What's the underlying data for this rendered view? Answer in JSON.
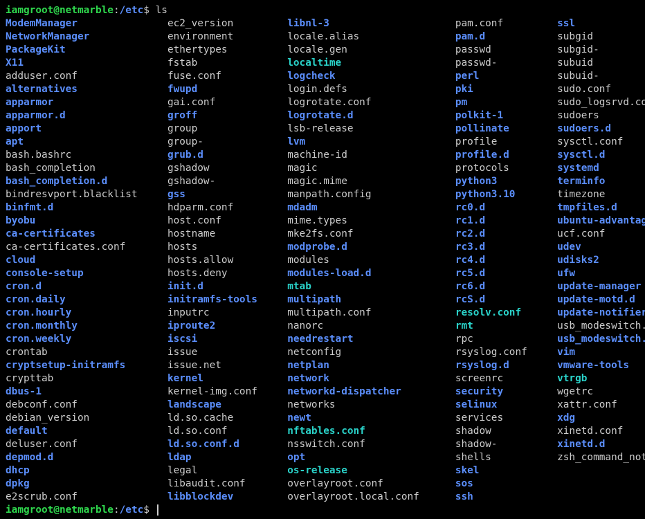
{
  "prompt": {
    "user": "iamgroot",
    "at": "@",
    "host": "netmarble",
    "colon": ":",
    "path": "/etc",
    "dollar": "$ "
  },
  "command": "ls",
  "cols_widths_ch": [
    27,
    20,
    28,
    17,
    0
  ],
  "listing": [
    [
      {
        "t": "ModemManager",
        "c": "d"
      },
      {
        "t": "ec2_version",
        "c": "n"
      },
      {
        "t": "libnl-3",
        "c": "d"
      },
      {
        "t": "pam.conf",
        "c": "n"
      },
      {
        "t": "ssl",
        "c": "d"
      }
    ],
    [
      {
        "t": "NetworkManager",
        "c": "d"
      },
      {
        "t": "environment",
        "c": "n"
      },
      {
        "t": "locale.alias",
        "c": "n"
      },
      {
        "t": "pam.d",
        "c": "d"
      },
      {
        "t": "subgid",
        "c": "n"
      }
    ],
    [
      {
        "t": "PackageKit",
        "c": "d"
      },
      {
        "t": "ethertypes",
        "c": "n"
      },
      {
        "t": "locale.gen",
        "c": "n"
      },
      {
        "t": "passwd",
        "c": "n"
      },
      {
        "t": "subgid-",
        "c": "n"
      }
    ],
    [
      {
        "t": "X11",
        "c": "d"
      },
      {
        "t": "fstab",
        "c": "n"
      },
      {
        "t": "localtime",
        "c": "l"
      },
      {
        "t": "passwd-",
        "c": "n"
      },
      {
        "t": "subuid",
        "c": "n"
      }
    ],
    [
      {
        "t": "adduser.conf",
        "c": "n"
      },
      {
        "t": "fuse.conf",
        "c": "n"
      },
      {
        "t": "logcheck",
        "c": "d"
      },
      {
        "t": "perl",
        "c": "d"
      },
      {
        "t": "subuid-",
        "c": "n"
      }
    ],
    [
      {
        "t": "alternatives",
        "c": "d"
      },
      {
        "t": "fwupd",
        "c": "d"
      },
      {
        "t": "login.defs",
        "c": "n"
      },
      {
        "t": "pki",
        "c": "d"
      },
      {
        "t": "sudo.conf",
        "c": "n"
      }
    ],
    [
      {
        "t": "apparmor",
        "c": "d"
      },
      {
        "t": "gai.conf",
        "c": "n"
      },
      {
        "t": "logrotate.conf",
        "c": "n"
      },
      {
        "t": "pm",
        "c": "d"
      },
      {
        "t": "sudo_logsrvd.conf",
        "c": "n"
      }
    ],
    [
      {
        "t": "apparmor.d",
        "c": "d"
      },
      {
        "t": "groff",
        "c": "d"
      },
      {
        "t": "logrotate.d",
        "c": "d"
      },
      {
        "t": "polkit-1",
        "c": "d"
      },
      {
        "t": "sudoers",
        "c": "n"
      }
    ],
    [
      {
        "t": "apport",
        "c": "d"
      },
      {
        "t": "group",
        "c": "n"
      },
      {
        "t": "lsb-release",
        "c": "n"
      },
      {
        "t": "pollinate",
        "c": "d"
      },
      {
        "t": "sudoers.d",
        "c": "d"
      }
    ],
    [
      {
        "t": "apt",
        "c": "d"
      },
      {
        "t": "group-",
        "c": "n"
      },
      {
        "t": "lvm",
        "c": "d"
      },
      {
        "t": "profile",
        "c": "n"
      },
      {
        "t": "sysctl.conf",
        "c": "n"
      }
    ],
    [
      {
        "t": "bash.bashrc",
        "c": "n"
      },
      {
        "t": "grub.d",
        "c": "d"
      },
      {
        "t": "machine-id",
        "c": "n"
      },
      {
        "t": "profile.d",
        "c": "d"
      },
      {
        "t": "sysctl.d",
        "c": "d"
      }
    ],
    [
      {
        "t": "bash_completion",
        "c": "n"
      },
      {
        "t": "gshadow",
        "c": "n"
      },
      {
        "t": "magic",
        "c": "n"
      },
      {
        "t": "protocols",
        "c": "n"
      },
      {
        "t": "systemd",
        "c": "d"
      }
    ],
    [
      {
        "t": "bash_completion.d",
        "c": "d"
      },
      {
        "t": "gshadow-",
        "c": "n"
      },
      {
        "t": "magic.mime",
        "c": "n"
      },
      {
        "t": "python3",
        "c": "d"
      },
      {
        "t": "terminfo",
        "c": "d"
      }
    ],
    [
      {
        "t": "bindresvport.blacklist",
        "c": "n"
      },
      {
        "t": "gss",
        "c": "d"
      },
      {
        "t": "manpath.config",
        "c": "n"
      },
      {
        "t": "python3.10",
        "c": "d"
      },
      {
        "t": "timezone",
        "c": "n"
      }
    ],
    [
      {
        "t": "binfmt.d",
        "c": "d"
      },
      {
        "t": "hdparm.conf",
        "c": "n"
      },
      {
        "t": "mdadm",
        "c": "d"
      },
      {
        "t": "rc0.d",
        "c": "d"
      },
      {
        "t": "tmpfiles.d",
        "c": "d"
      }
    ],
    [
      {
        "t": "byobu",
        "c": "d"
      },
      {
        "t": "host.conf",
        "c": "n"
      },
      {
        "t": "mime.types",
        "c": "n"
      },
      {
        "t": "rc1.d",
        "c": "d"
      },
      {
        "t": "ubuntu-advantage",
        "c": "d"
      }
    ],
    [
      {
        "t": "ca-certificates",
        "c": "d"
      },
      {
        "t": "hostname",
        "c": "n"
      },
      {
        "t": "mke2fs.conf",
        "c": "n"
      },
      {
        "t": "rc2.d",
        "c": "d"
      },
      {
        "t": "ucf.conf",
        "c": "n"
      }
    ],
    [
      {
        "t": "ca-certificates.conf",
        "c": "n"
      },
      {
        "t": "hosts",
        "c": "n"
      },
      {
        "t": "modprobe.d",
        "c": "d"
      },
      {
        "t": "rc3.d",
        "c": "d"
      },
      {
        "t": "udev",
        "c": "d"
      }
    ],
    [
      {
        "t": "cloud",
        "c": "d"
      },
      {
        "t": "hosts.allow",
        "c": "n"
      },
      {
        "t": "modules",
        "c": "n"
      },
      {
        "t": "rc4.d",
        "c": "d"
      },
      {
        "t": "udisks2",
        "c": "d"
      }
    ],
    [
      {
        "t": "console-setup",
        "c": "d"
      },
      {
        "t": "hosts.deny",
        "c": "n"
      },
      {
        "t": "modules-load.d",
        "c": "d"
      },
      {
        "t": "rc5.d",
        "c": "d"
      },
      {
        "t": "ufw",
        "c": "d"
      }
    ],
    [
      {
        "t": "cron.d",
        "c": "d"
      },
      {
        "t": "init.d",
        "c": "d"
      },
      {
        "t": "mtab",
        "c": "l"
      },
      {
        "t": "rc6.d",
        "c": "d"
      },
      {
        "t": "update-manager",
        "c": "d"
      }
    ],
    [
      {
        "t": "cron.daily",
        "c": "d"
      },
      {
        "t": "initramfs-tools",
        "c": "d"
      },
      {
        "t": "multipath",
        "c": "d"
      },
      {
        "t": "rcS.d",
        "c": "d"
      },
      {
        "t": "update-motd.d",
        "c": "d"
      }
    ],
    [
      {
        "t": "cron.hourly",
        "c": "d"
      },
      {
        "t": "inputrc",
        "c": "n"
      },
      {
        "t": "multipath.conf",
        "c": "n"
      },
      {
        "t": "resolv.conf",
        "c": "l"
      },
      {
        "t": "update-notifier",
        "c": "d"
      }
    ],
    [
      {
        "t": "cron.monthly",
        "c": "d"
      },
      {
        "t": "iproute2",
        "c": "d"
      },
      {
        "t": "nanorc",
        "c": "n"
      },
      {
        "t": "rmt",
        "c": "l"
      },
      {
        "t": "usb_modeswitch.conf",
        "c": "n"
      }
    ],
    [
      {
        "t": "cron.weekly",
        "c": "d"
      },
      {
        "t": "iscsi",
        "c": "d"
      },
      {
        "t": "needrestart",
        "c": "d"
      },
      {
        "t": "rpc",
        "c": "n"
      },
      {
        "t": "usb_modeswitch.d",
        "c": "d"
      }
    ],
    [
      {
        "t": "crontab",
        "c": "n"
      },
      {
        "t": "issue",
        "c": "n"
      },
      {
        "t": "netconfig",
        "c": "n"
      },
      {
        "t": "rsyslog.conf",
        "c": "n"
      },
      {
        "t": "vim",
        "c": "d"
      }
    ],
    [
      {
        "t": "cryptsetup-initramfs",
        "c": "d"
      },
      {
        "t": "issue.net",
        "c": "n"
      },
      {
        "t": "netplan",
        "c": "d"
      },
      {
        "t": "rsyslog.d",
        "c": "d"
      },
      {
        "t": "vmware-tools",
        "c": "d"
      }
    ],
    [
      {
        "t": "crypttab",
        "c": "n"
      },
      {
        "t": "kernel",
        "c": "d"
      },
      {
        "t": "network",
        "c": "d"
      },
      {
        "t": "screenrc",
        "c": "n"
      },
      {
        "t": "vtrgb",
        "c": "l"
      }
    ],
    [
      {
        "t": "dbus-1",
        "c": "d"
      },
      {
        "t": "kernel-img.conf",
        "c": "n"
      },
      {
        "t": "networkd-dispatcher",
        "c": "d"
      },
      {
        "t": "security",
        "c": "d"
      },
      {
        "t": "wgetrc",
        "c": "n"
      }
    ],
    [
      {
        "t": "debconf.conf",
        "c": "n"
      },
      {
        "t": "landscape",
        "c": "d"
      },
      {
        "t": "networks",
        "c": "n"
      },
      {
        "t": "selinux",
        "c": "d"
      },
      {
        "t": "xattr.conf",
        "c": "n"
      }
    ],
    [
      {
        "t": "debian_version",
        "c": "n"
      },
      {
        "t": "ld.so.cache",
        "c": "n"
      },
      {
        "t": "newt",
        "c": "d"
      },
      {
        "t": "services",
        "c": "n"
      },
      {
        "t": "xdg",
        "c": "d"
      }
    ],
    [
      {
        "t": "default",
        "c": "d"
      },
      {
        "t": "ld.so.conf",
        "c": "n"
      },
      {
        "t": "nftables.conf",
        "c": "l"
      },
      {
        "t": "shadow",
        "c": "n"
      },
      {
        "t": "xinetd.conf",
        "c": "n"
      }
    ],
    [
      {
        "t": "deluser.conf",
        "c": "n"
      },
      {
        "t": "ld.so.conf.d",
        "c": "d"
      },
      {
        "t": "nsswitch.conf",
        "c": "n"
      },
      {
        "t": "shadow-",
        "c": "n"
      },
      {
        "t": "xinetd.d",
        "c": "d"
      }
    ],
    [
      {
        "t": "depmod.d",
        "c": "d"
      },
      {
        "t": "ldap",
        "c": "d"
      },
      {
        "t": "opt",
        "c": "d"
      },
      {
        "t": "shells",
        "c": "n"
      },
      {
        "t": "zsh_command_not_found",
        "c": "n"
      }
    ],
    [
      {
        "t": "dhcp",
        "c": "d"
      },
      {
        "t": "legal",
        "c": "n"
      },
      {
        "t": "os-release",
        "c": "l"
      },
      {
        "t": "skel",
        "c": "d"
      },
      {
        "t": "",
        "c": "n"
      }
    ],
    [
      {
        "t": "dpkg",
        "c": "d"
      },
      {
        "t": "libaudit.conf",
        "c": "n"
      },
      {
        "t": "overlayroot.conf",
        "c": "n"
      },
      {
        "t": "sos",
        "c": "d"
      },
      {
        "t": "",
        "c": "n"
      }
    ],
    [
      {
        "t": "e2scrub.conf",
        "c": "n"
      },
      {
        "t": "libblockdev",
        "c": "d"
      },
      {
        "t": "overlayroot.local.conf",
        "c": "n"
      },
      {
        "t": "ssh",
        "c": "d"
      },
      {
        "t": "",
        "c": "n"
      }
    ]
  ]
}
